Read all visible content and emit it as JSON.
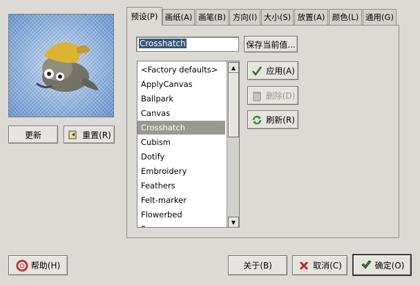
{
  "preview": {
    "refresh_label": "更新",
    "reset_label": "重置(R)"
  },
  "tabs": [
    {
      "label": "预设(P)",
      "active": true
    },
    {
      "label": "画纸(A)"
    },
    {
      "label": "画笔(B)"
    },
    {
      "label": "方向(I)"
    },
    {
      "label": "大小(S)"
    },
    {
      "label": "放置(A)"
    },
    {
      "label": "颜色(L)"
    },
    {
      "label": "通用(G)"
    }
  ],
  "presets": {
    "name_value": "Crosshatch",
    "save_label": "保存当前值...",
    "items": [
      "<Factory defaults>",
      "ApplyCanvas",
      "Ballpark",
      "Canvas",
      "Crosshatch",
      "Cubism",
      "Dotify",
      "Embroidery",
      "Feathers",
      "Felt-marker",
      "Flowerbed",
      "F"
    ],
    "selected_index": 4,
    "apply_label": "应用(A)",
    "delete_label": "删除(D)",
    "refresh_label": "刷新(R)"
  },
  "footer": {
    "help_label": "帮助(H)",
    "about_label": "关于(B)",
    "cancel_label": "取消(C)",
    "ok_label": "确定(O)"
  },
  "colors": {
    "background": "#dcdad5",
    "selection": "#9a9893",
    "input_selection": "#36557e",
    "cancel_x": "#d42020",
    "apply_check": "#2a6a2a",
    "refresh_arrows": "#3a8a3a"
  },
  "icons": {
    "reset": "reset-icon",
    "apply": "check-icon",
    "delete": "trash-icon",
    "refresh": "refresh-icon",
    "help": "lifebuoy-icon",
    "cancel": "x-icon",
    "ok": "ok-icon"
  }
}
